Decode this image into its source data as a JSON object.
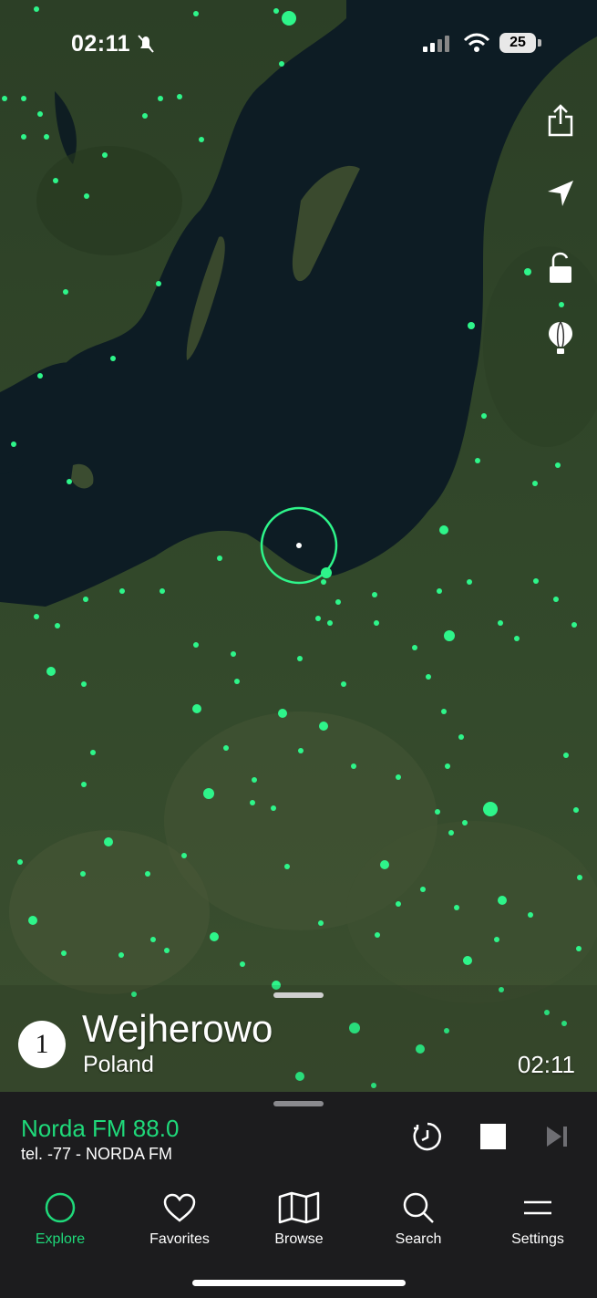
{
  "status_bar": {
    "time": "02:11",
    "battery": "25"
  },
  "map": {
    "accent_color": "#2ef58a",
    "selected_city": {
      "rank": "1",
      "name": "Wejherowo",
      "country": "Poland",
      "local_time": "02:11"
    }
  },
  "map_controls": [
    "share-icon",
    "location-arrow-icon",
    "unlock-icon",
    "balloon-icon"
  ],
  "player": {
    "station": "Norda FM 88.0",
    "track": "tel. -77 - NORDA FM"
  },
  "tabs": [
    {
      "label": "Explore",
      "icon": "explore-circle-icon",
      "active": true
    },
    {
      "label": "Favorites",
      "icon": "heart-icon",
      "active": false
    },
    {
      "label": "Browse",
      "icon": "map-icon",
      "active": false
    },
    {
      "label": "Search",
      "icon": "search-icon",
      "active": false
    },
    {
      "label": "Settings",
      "icon": "menu-icon",
      "active": false
    }
  ]
}
